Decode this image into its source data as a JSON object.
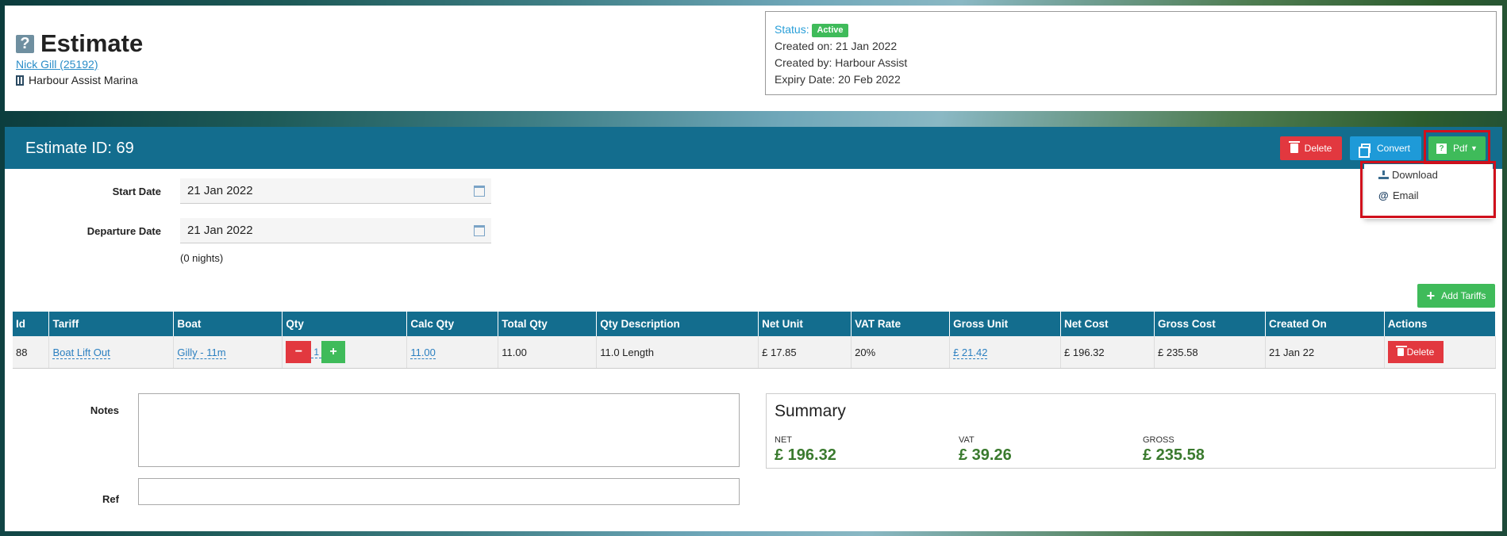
{
  "header": {
    "title": "Estimate",
    "customer_link": "Nick Gill (25192)",
    "marina": "Harbour Assist Marina"
  },
  "status_box": {
    "status_label": "Status:",
    "status_value": "Active",
    "created_on": "Created on: 21 Jan 2022",
    "created_by": "Created by: Harbour Assist",
    "expiry": "Expiry Date: 20 Feb 2022"
  },
  "panel": {
    "estimate_id": "Estimate ID: 69",
    "delete_label": "Delete",
    "convert_label": "Convert",
    "pdf_label": "Pdf",
    "pdf_menu": {
      "download": "Download",
      "email": "Email"
    }
  },
  "form": {
    "start_date_label": "Start Date",
    "start_date_value": "21 Jan 2022",
    "departure_date_label": "Departure Date",
    "departure_date_value": "21 Jan 2022",
    "nights": "(0 nights)",
    "add_tariffs_label": "Add Tariffs"
  },
  "table": {
    "columns": [
      "Id",
      "Tariff",
      "Boat",
      "Qty",
      "Calc Qty",
      "Total Qty",
      "Qty Description",
      "Net Unit",
      "VAT Rate",
      "Gross Unit",
      "Net Cost",
      "Gross Cost",
      "Created On",
      "Actions"
    ],
    "rows": [
      {
        "id": "88",
        "tariff": "Boat Lift Out",
        "boat": "Gilly - 11m",
        "qty": "1",
        "calc_qty": "11.00",
        "total_qty": "11.00",
        "qty_description": "11.0 Length",
        "net_unit": "£ 17.85",
        "vat_rate": "20%",
        "gross_unit": "£ 21.42",
        "net_cost": "£ 196.32",
        "gross_cost": "£ 235.58",
        "created_on": "21 Jan 22",
        "action_delete": "Delete"
      }
    ]
  },
  "notes": {
    "notes_label": "Notes",
    "notes_value": "",
    "ref_label": "Ref",
    "ref_value": ""
  },
  "summary": {
    "title": "Summary",
    "net_label": "NET",
    "net_value": "£ 196.32",
    "vat_label": "VAT",
    "vat_value": "£ 39.26",
    "gross_label": "GROSS",
    "gross_value": "£ 235.58"
  },
  "colors": {
    "header_bar": "#136d8e",
    "success": "#3fbb5a",
    "danger": "#e2383f",
    "info": "#1e9ad8",
    "highlight": "#d0101c"
  }
}
